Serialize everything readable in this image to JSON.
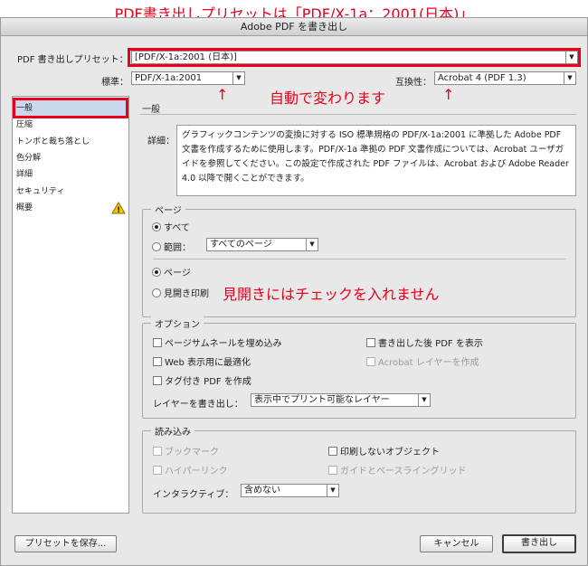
{
  "top_annotation": "PDF書き出しプリセットは「PDF/X-1a：2001(日本)」",
  "window_title": "Adobe PDF を書き出し",
  "preset": {
    "label": "PDF 書き出しプリセット：",
    "value": "[PDF/X-1a:2001 (日本)]"
  },
  "standard": {
    "label": "標準：",
    "value": "PDF/X-1a:2001"
  },
  "compat": {
    "label": "互換性：",
    "value": "Acrobat 4 (PDF 1.3)"
  },
  "annotation_auto": "自動で変わります",
  "annotation_arrow": "↑",
  "sidebar": {
    "items": [
      {
        "label": "一般"
      },
      {
        "label": "圧縮"
      },
      {
        "label": "トンボと裁ち落とし"
      },
      {
        "label": "色分解"
      },
      {
        "label": "詳細"
      },
      {
        "label": "セキュリティ"
      },
      {
        "label": "概要"
      }
    ],
    "warning_glyph": "!"
  },
  "panel": {
    "title": "一般",
    "detail_label": "詳細：",
    "detail_text": "グラフィックコンテンツの変換に対する ISO 標準規格の PDF/X-1a:2001 に準拠した Adobe PDF 文書を作成するために使用します。PDF/X-1a 準拠の PDF 文書作成については、Acrobat ユーザガイドを参照してください。この設定で作成された PDF ファイルは、Acrobat および Adobe Reader 4.0 以降で開くことができます。"
  },
  "pages": {
    "group_title": "ページ",
    "all_label": "すべて",
    "range_label": "範囲：",
    "range_value": "すべてのページ",
    "pages_label": "ページ",
    "spreads_label": "見開き印刷",
    "annotation": "見開きにはチェックを入れません"
  },
  "options": {
    "group_title": "オプション",
    "embed_thumbnails": "ページサムネールを埋め込み",
    "optimize_web": "Web 表示用に最適化",
    "tagged_pdf": "タグ付き PDF を作成",
    "view_after": "書き出した後 PDF を表示",
    "acrobat_layers": "Acrobat レイヤーを作成",
    "layers_label": "レイヤーを書き出し：",
    "layers_value": "表示中でプリント可能なレイヤー"
  },
  "include": {
    "group_title": "読み込み",
    "bookmarks": "ブックマーク",
    "hyperlinks": "ハイパーリンク",
    "nonprinting": "印刷しないオブジェクト",
    "guides": "ガイドとベースライングリッド",
    "interactive_label": "インタラクティブ：",
    "interactive_value": "含めない"
  },
  "buttons": {
    "save_preset": "プリセットを保存...",
    "cancel": "キャンセル",
    "export": "書き出し"
  }
}
